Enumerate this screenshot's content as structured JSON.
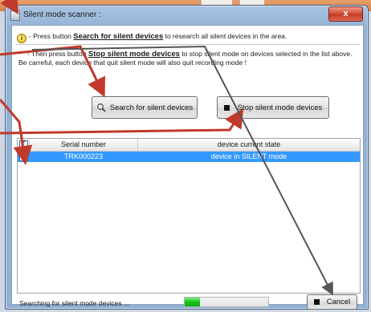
{
  "window": {
    "title": "Silent mode scanner :",
    "close_label": "x"
  },
  "info": {
    "line1_prefix": "- Press button ",
    "line1_button": "Search for silent devices",
    "line1_suffix": " to research all silent devices in the area.",
    "line2_prefix": "- Then press button ",
    "line2_button": "Stop silent mode devices",
    "line2_suffix": " to stop silent mode on devices selected in the list above.",
    "line3": "Be carreful, each device that quit silent mode will also quit recording mode !"
  },
  "buttons": {
    "search": "Search for silent devices",
    "stop": "Stop silent mode devices",
    "cancel": "Cancel"
  },
  "grid": {
    "columns": [
      "Serial number",
      "device current state"
    ],
    "rows": [
      {
        "checked": true,
        "serial": "TRK000223",
        "state": "device in SILENT mode"
      }
    ]
  },
  "status": {
    "text": "Searching for silent mode devices ...",
    "progress": 0.18
  },
  "colors": {
    "selection": "#3399ff",
    "annotation_arrow": "#c0392b",
    "progress": "#15c315"
  },
  "icons": {
    "search": "magnifier-icon",
    "stop": "stop-square-icon",
    "info": "info-icon"
  }
}
